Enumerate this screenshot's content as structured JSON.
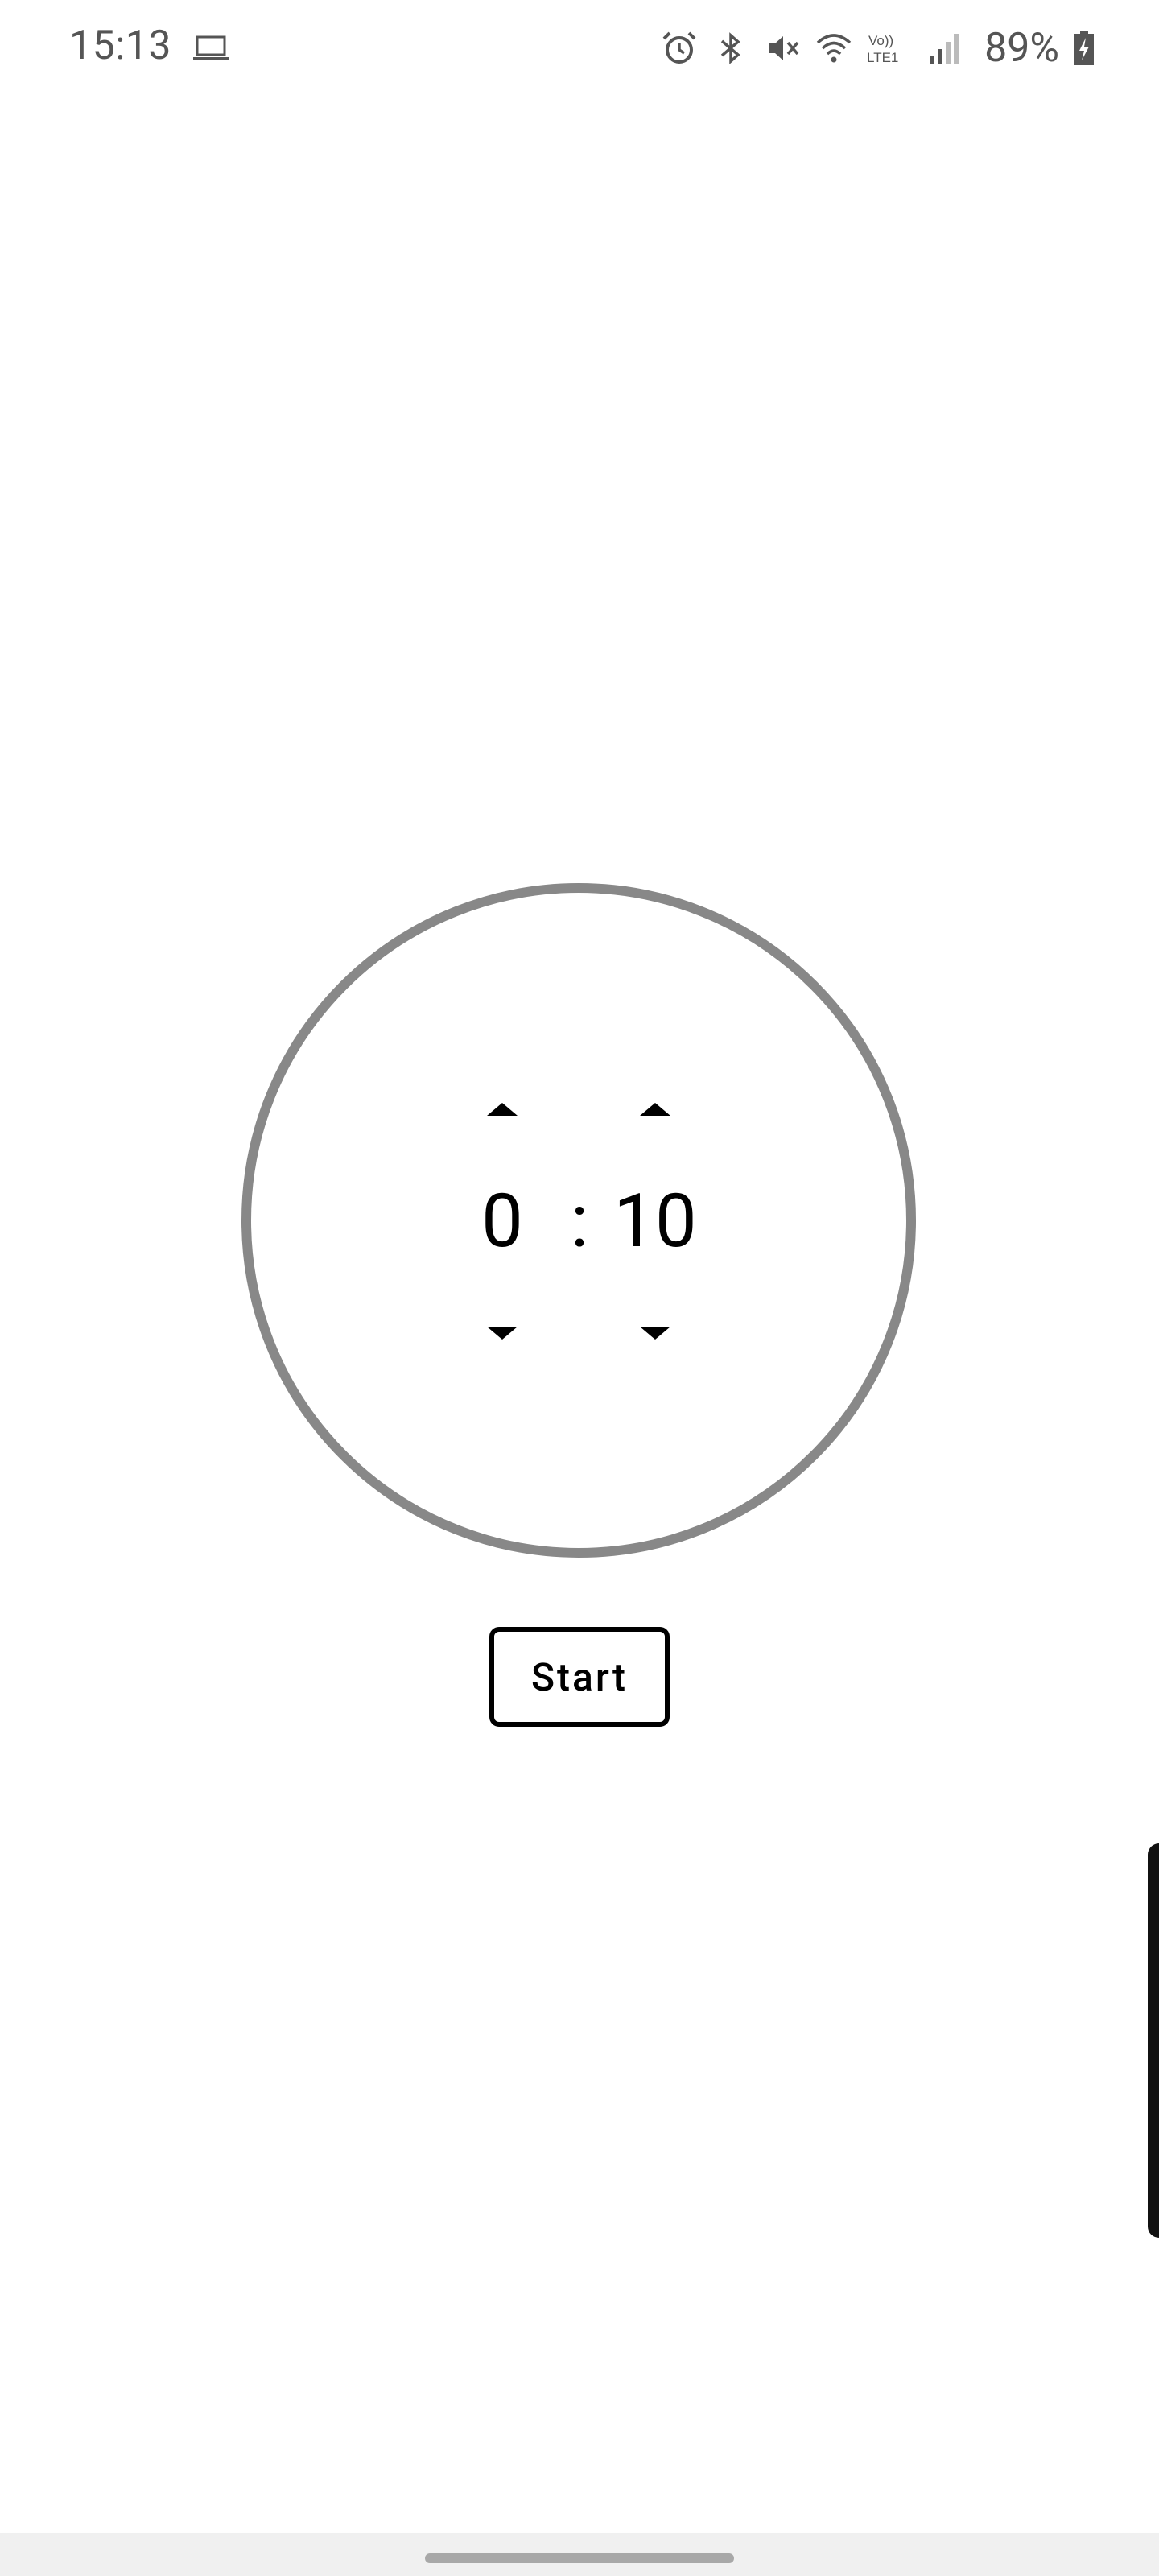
{
  "status_bar": {
    "time": "15:13",
    "battery_percent": "89%",
    "icons": [
      "laptop-icon",
      "alarm-icon",
      "bluetooth-icon",
      "mute-icon",
      "wifi-icon",
      "volte-icon",
      "signal-icon",
      "battery-charging-icon"
    ],
    "volte_text": "Vo)) LTE1"
  },
  "timer": {
    "minutes": "0",
    "separator": ":",
    "seconds": "10",
    "ring_color": "#888888"
  },
  "controls": {
    "start_label": "Start"
  }
}
